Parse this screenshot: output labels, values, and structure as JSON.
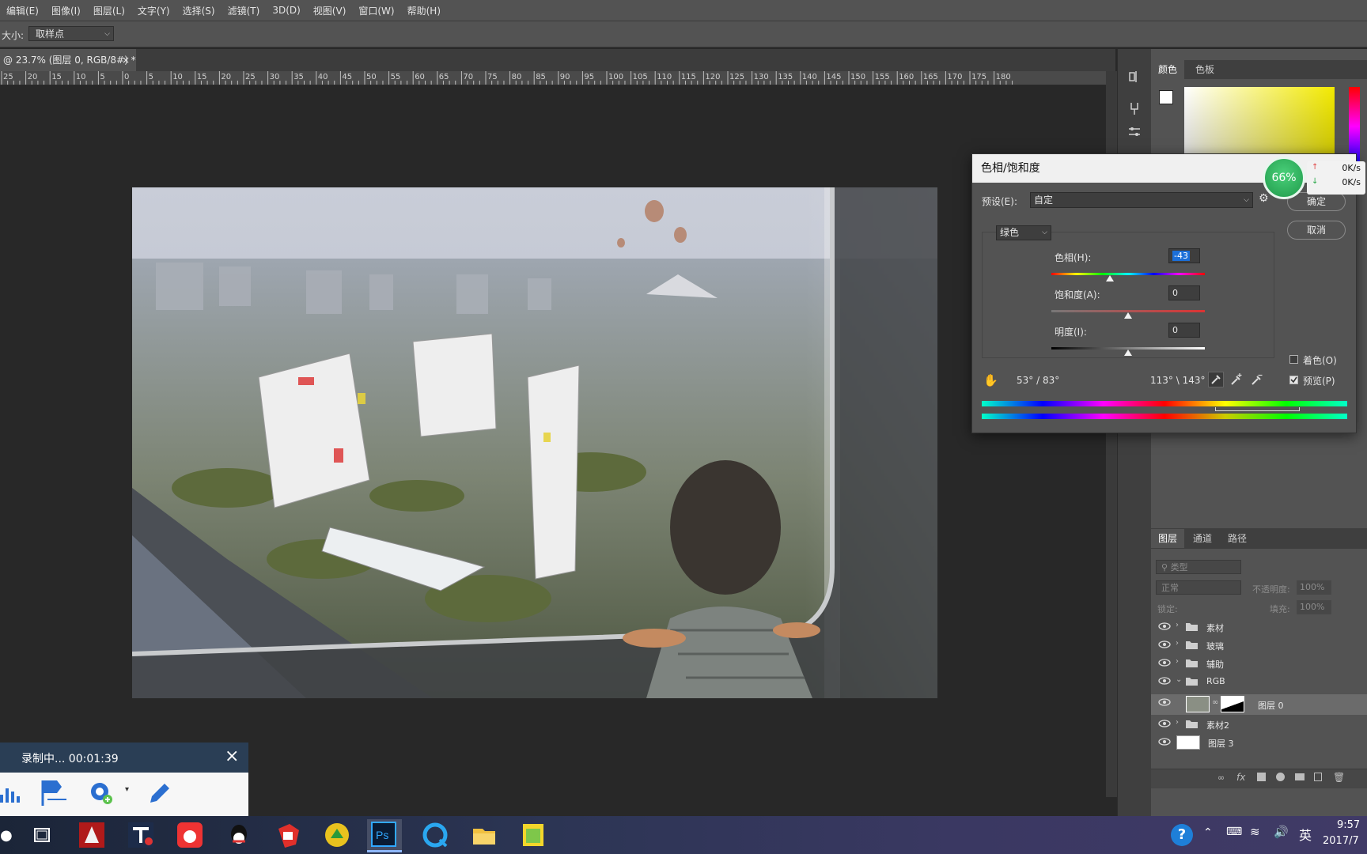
{
  "menu": [
    "编辑(E)",
    "图像(I)",
    "图层(L)",
    "文字(Y)",
    "选择(S)",
    "滤镜(T)",
    "3D(D)",
    "视图(V)",
    "窗口(W)",
    "帮助(H)"
  ],
  "options": {
    "size_label": "大小:",
    "size_value": "取样点"
  },
  "document": {
    "tab_title": "@ 23.7% (图层 0, RGB/8#) *",
    "close": "×"
  },
  "ruler": {
    "labels": [
      "25",
      "20",
      "15",
      "10",
      "5",
      "0",
      "5",
      "10",
      "15",
      "20",
      "25",
      "30",
      "35",
      "40",
      "45",
      "50",
      "55",
      "60",
      "65",
      "70",
      "75",
      "80",
      "85",
      "90",
      "95",
      "100",
      "105",
      "110",
      "115",
      "120",
      "125",
      "130",
      "135",
      "140",
      "145",
      "150",
      "155",
      "160",
      "165",
      "170",
      "175",
      "180"
    ]
  },
  "panels": {
    "color_tabs": [
      "颜色",
      "色板"
    ],
    "layers_tabs": [
      "图层",
      "通道",
      "路径"
    ],
    "filter_placeholder": "类型",
    "blend_mode": "正常",
    "opacity_label": "不透明度:",
    "opacity_value": "100%",
    "lock_label": "锁定:",
    "fill_label": "填充:",
    "fill_value": "100%",
    "fg_color": "#ffffff",
    "bg_color": "#7a7a1a"
  },
  "layers": [
    {
      "name": "素材",
      "type": "group"
    },
    {
      "name": "玻璃",
      "type": "group"
    },
    {
      "name": "辅助",
      "type": "group"
    },
    {
      "name": "RGB",
      "type": "group-open"
    },
    {
      "name": "图层 0",
      "type": "layer-mask",
      "selected": true
    },
    {
      "name": "素材2",
      "type": "group"
    },
    {
      "name": "图层 3",
      "type": "layer"
    }
  ],
  "dialog": {
    "title": "色相/饱和度",
    "preset_label": "预设(E):",
    "preset_value": "自定",
    "ok": "确定",
    "cancel": "取消",
    "channel": "绿色",
    "hue_label": "色相(H):",
    "hue_value": "-43",
    "sat_label": "饱和度(A):",
    "sat_value": "0",
    "light_label": "明度(I):",
    "light_value": "0",
    "colorize_label": "着色(O)",
    "colorize_checked": false,
    "preview_label": "预览(P)",
    "preview_checked": true,
    "range_left": "53° / 83°",
    "range_right": "113° \\ 143°"
  },
  "network": {
    "percent": "66%",
    "up": "0K/s",
    "down": "0K/s"
  },
  "recorder": {
    "status": "录制中... 00:01:39",
    "close": "×"
  },
  "taskbar": {
    "time": "9:57",
    "date": "2017/7",
    "ime": "英"
  }
}
